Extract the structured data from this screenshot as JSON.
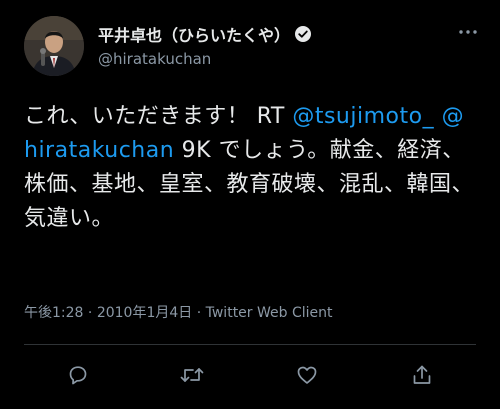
{
  "author": {
    "display_name": "平井卓也（ひらいたくや）",
    "handle": "@hiratakuchan",
    "verified": true
  },
  "tweet": {
    "text_part1": "これ、いただきます！ RT ",
    "mention1": "@tsujimoto_",
    "text_space": " ",
    "mention2": "@hiratakuchan",
    "text_part2": " 9K でしょう。献金、経済、株価、基地、皇室、教育破壊、混乱、韓国、気違い。"
  },
  "meta": {
    "time": "午後1:28",
    "date": "2010年1月4日",
    "client": "Twitter Web Client",
    "separator": "·"
  },
  "icons": {
    "more": "more-horizontal-icon",
    "reply": "reply-icon",
    "retweet": "retweet-icon",
    "like": "heart-icon",
    "share": "share-icon",
    "verified": "verified-badge-icon"
  },
  "colors": {
    "background": "#000000",
    "text": "#e7e9ea",
    "secondary": "#8b98a5",
    "link": "#1d9bf0",
    "divider": "#2f3336"
  }
}
